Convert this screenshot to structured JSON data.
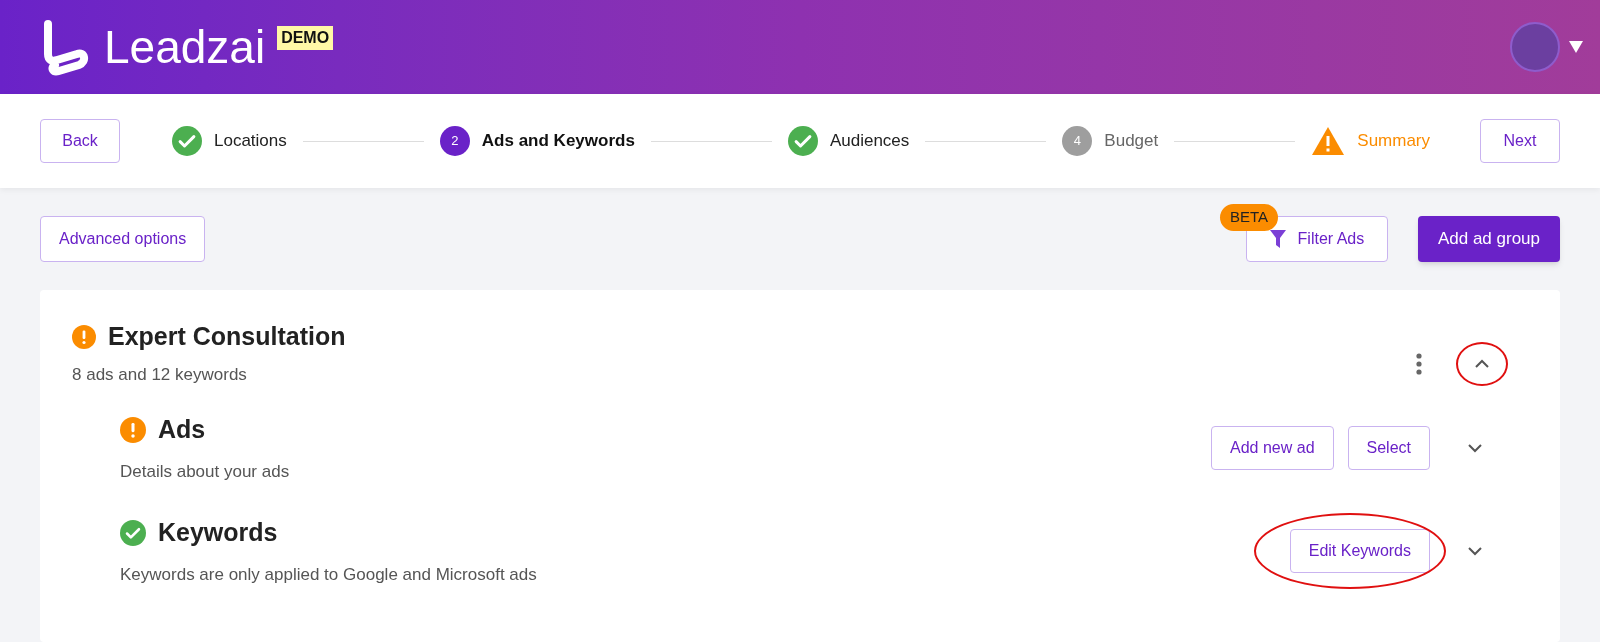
{
  "header": {
    "logo_text": "Leadzai",
    "badge": "DEMO"
  },
  "stepper": {
    "back": "Back",
    "next": "Next",
    "steps": [
      {
        "label": "Locations",
        "kind": "done"
      },
      {
        "label": "Ads and Keywords",
        "kind": "current",
        "number": "2"
      },
      {
        "label": "Audiences",
        "kind": "done"
      },
      {
        "label": "Budget",
        "kind": "pending",
        "number": "4"
      },
      {
        "label": "Summary",
        "kind": "warning"
      }
    ]
  },
  "toolbar": {
    "advanced": "Advanced options",
    "filter": {
      "label": "Filter Ads",
      "badge": "BETA"
    },
    "add_group": "Add ad group"
  },
  "ad_group": {
    "title": "Expert Consultation",
    "kind": "warning",
    "subtitle": "8 ads and 12 keywords",
    "expanded": true,
    "collapse_highlighted": true,
    "sections": [
      {
        "title": "Ads",
        "kind": "warning",
        "description": "Details about your ads",
        "buttons": [
          {
            "label": "Add new ad",
            "highlighted": false
          },
          {
            "label": "Select",
            "highlighted": false
          }
        ],
        "expanded": false
      },
      {
        "title": "Keywords",
        "kind": "done",
        "description": "Keywords are only applied to Google and Microsoft ads",
        "buttons": [
          {
            "label": "Edit Keywords",
            "highlighted": true
          }
        ],
        "expanded": false
      }
    ]
  }
}
